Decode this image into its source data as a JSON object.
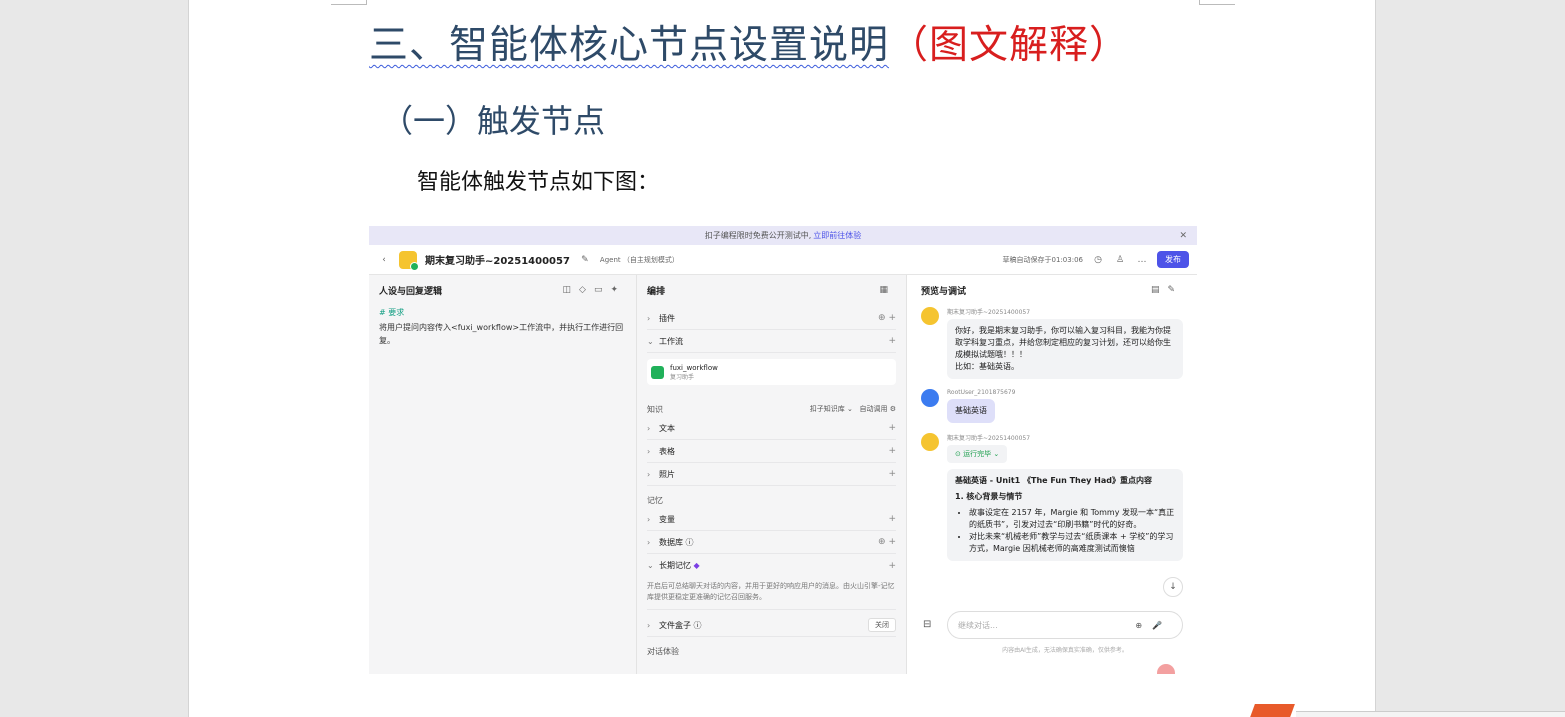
{
  "document": {
    "heading1_main": "三、智能体核心节点设置说明",
    "heading1_red": "（图文解释）",
    "heading2": "（一）触发节点",
    "body": "智能体触发节点如下图："
  },
  "screenshot": {
    "banner": {
      "text": "扣子编程限时免费公开测试中,",
      "link": "立即前往体验"
    },
    "topbar": {
      "app_name": "期末复习助手~20251400057",
      "mode": "Agent （自主规划模式）",
      "saved": "草稿自动保存于01:03:06",
      "publish": "发布"
    },
    "col1": {
      "title": "人设与回复逻辑",
      "req_heading": "# 要求",
      "req_text": "将用户提问内容传入<fuxi_workflow>工作流中，并执行工作进行回复。"
    },
    "col2": {
      "title": "编排",
      "plugin": "插件",
      "workflow": "工作流",
      "wf_name": "fuxi_workflow",
      "wf_desc": "复习助手",
      "knowledge": "知识",
      "kb": "扣子知识库",
      "auto_call": "自动调用",
      "text": "文本",
      "table": "表格",
      "photo": "照片",
      "memory": "记忆",
      "variable": "变量",
      "database": "数据库",
      "long_memory": "长期记忆",
      "long_memory_desc": "开启后可总结聊天对话的内容，并用于更好的响应用户的消息。由火山引擎-记忆库提供更稳定更准确的记忆召回服务。",
      "file_box": "文件盒子",
      "off": "关闭",
      "dialog": "对话体验"
    },
    "col3": {
      "title": "预览与调试",
      "bot_name": "期末复习助手~20251400057",
      "greeting": "你好，我是期末复习助手，你可以输入复习科目，我能为你提取学科复习重点，并给您制定相应的复习计划，还可以给你生成模拟试题哦！！！\n比如：基础英语。",
      "user_name": "RootUser_2101875679",
      "user_msg": "基础英语",
      "run_done": "运行完毕",
      "answer_title": "基础英语 - Unit1 《The Fun They Had》重点内容",
      "answer_sub": "1. 核心背景与情节",
      "bullet1": "故事设定在 2157 年，Margie 和 Tommy 发现一本“真正的纸质书”，引发对过去“印刷书籍”时代的好奇。",
      "bullet2": "对比未来“机械老师”教学与过去“纸质课本 + 学校”的学习方式，Margie 因机械老师的高难度测试而懊恼",
      "input_placeholder": "继续对话...",
      "disclaimer": "内容由AI生成，无法确保真实准确，仅供参考。"
    }
  }
}
